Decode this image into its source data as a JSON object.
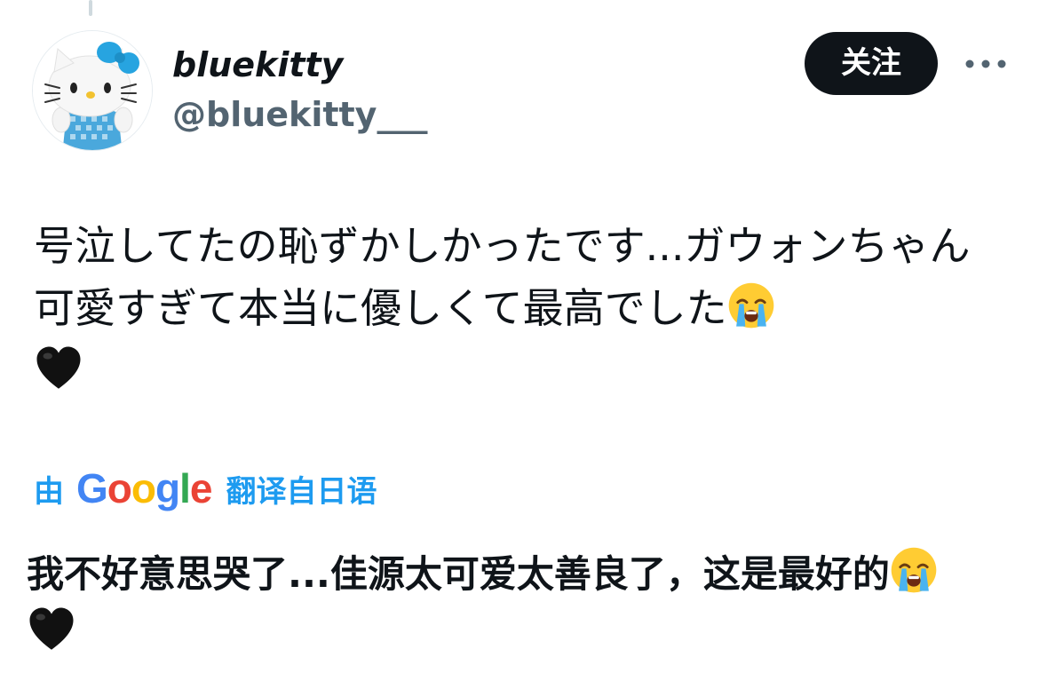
{
  "author": {
    "display_name": "bluekitty",
    "handle": "@bluekitty___"
  },
  "follow_label": "关注",
  "tweet": {
    "text": "号泣してたの恥ずかしかったです...ガウォンちゃん可愛すぎて本当に優しくて最高でした"
  },
  "translation": {
    "prefix": "由",
    "provider_letters": [
      "G",
      "o",
      "o",
      "g",
      "l",
      "e"
    ],
    "provider_colors": [
      "#4285F4",
      "#EA4335",
      "#FBBC05",
      "#4285F4",
      "#34A853",
      "#EA4335"
    ],
    "suffix": "翻译自日语",
    "text": "我不好意思哭了...佳源太可爱太善良了，这是最好的"
  },
  "icons": {
    "more": "more-horizontal-icon",
    "emoji_1": "loudly-crying-face-icon",
    "emoji_2": "black-heart-icon"
  },
  "colors": {
    "follow_bg": "#0f1419",
    "handle": "#536471",
    "translate_link": "#1d9bf0"
  }
}
